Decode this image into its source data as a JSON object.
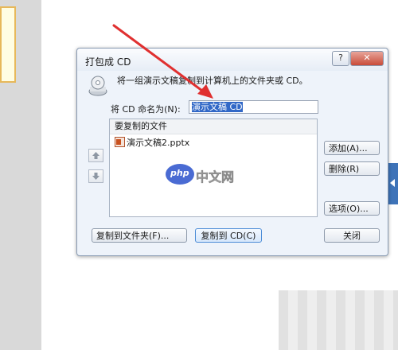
{
  "dialog": {
    "title": "打包成 CD",
    "help_label": "?",
    "close_label": "✕",
    "description": "将一组演示文稿复制到计算机上的文件夹或 CD。",
    "name_label": "将 CD 命名为(N):",
    "name_value": "演示文稿 CD",
    "files_header": "要复制的文件",
    "files": [
      {
        "name": "演示文稿2.pptx",
        "icon": "pptx-file-icon"
      }
    ],
    "buttons": {
      "add": "添加(A)...",
      "delete": "删除(R)",
      "options": "选项(O)...",
      "copy_to_folder": "复制到文件夹(F)...",
      "copy_to_cd": "复制到 CD(C)",
      "close": "关闭"
    }
  },
  "watermark": {
    "logo_text": "php",
    "site_text": "中文网"
  },
  "colors": {
    "annotation_arrow": "#e03030",
    "dialog_bg": "#eef3fa",
    "selection": "#3168c7"
  }
}
